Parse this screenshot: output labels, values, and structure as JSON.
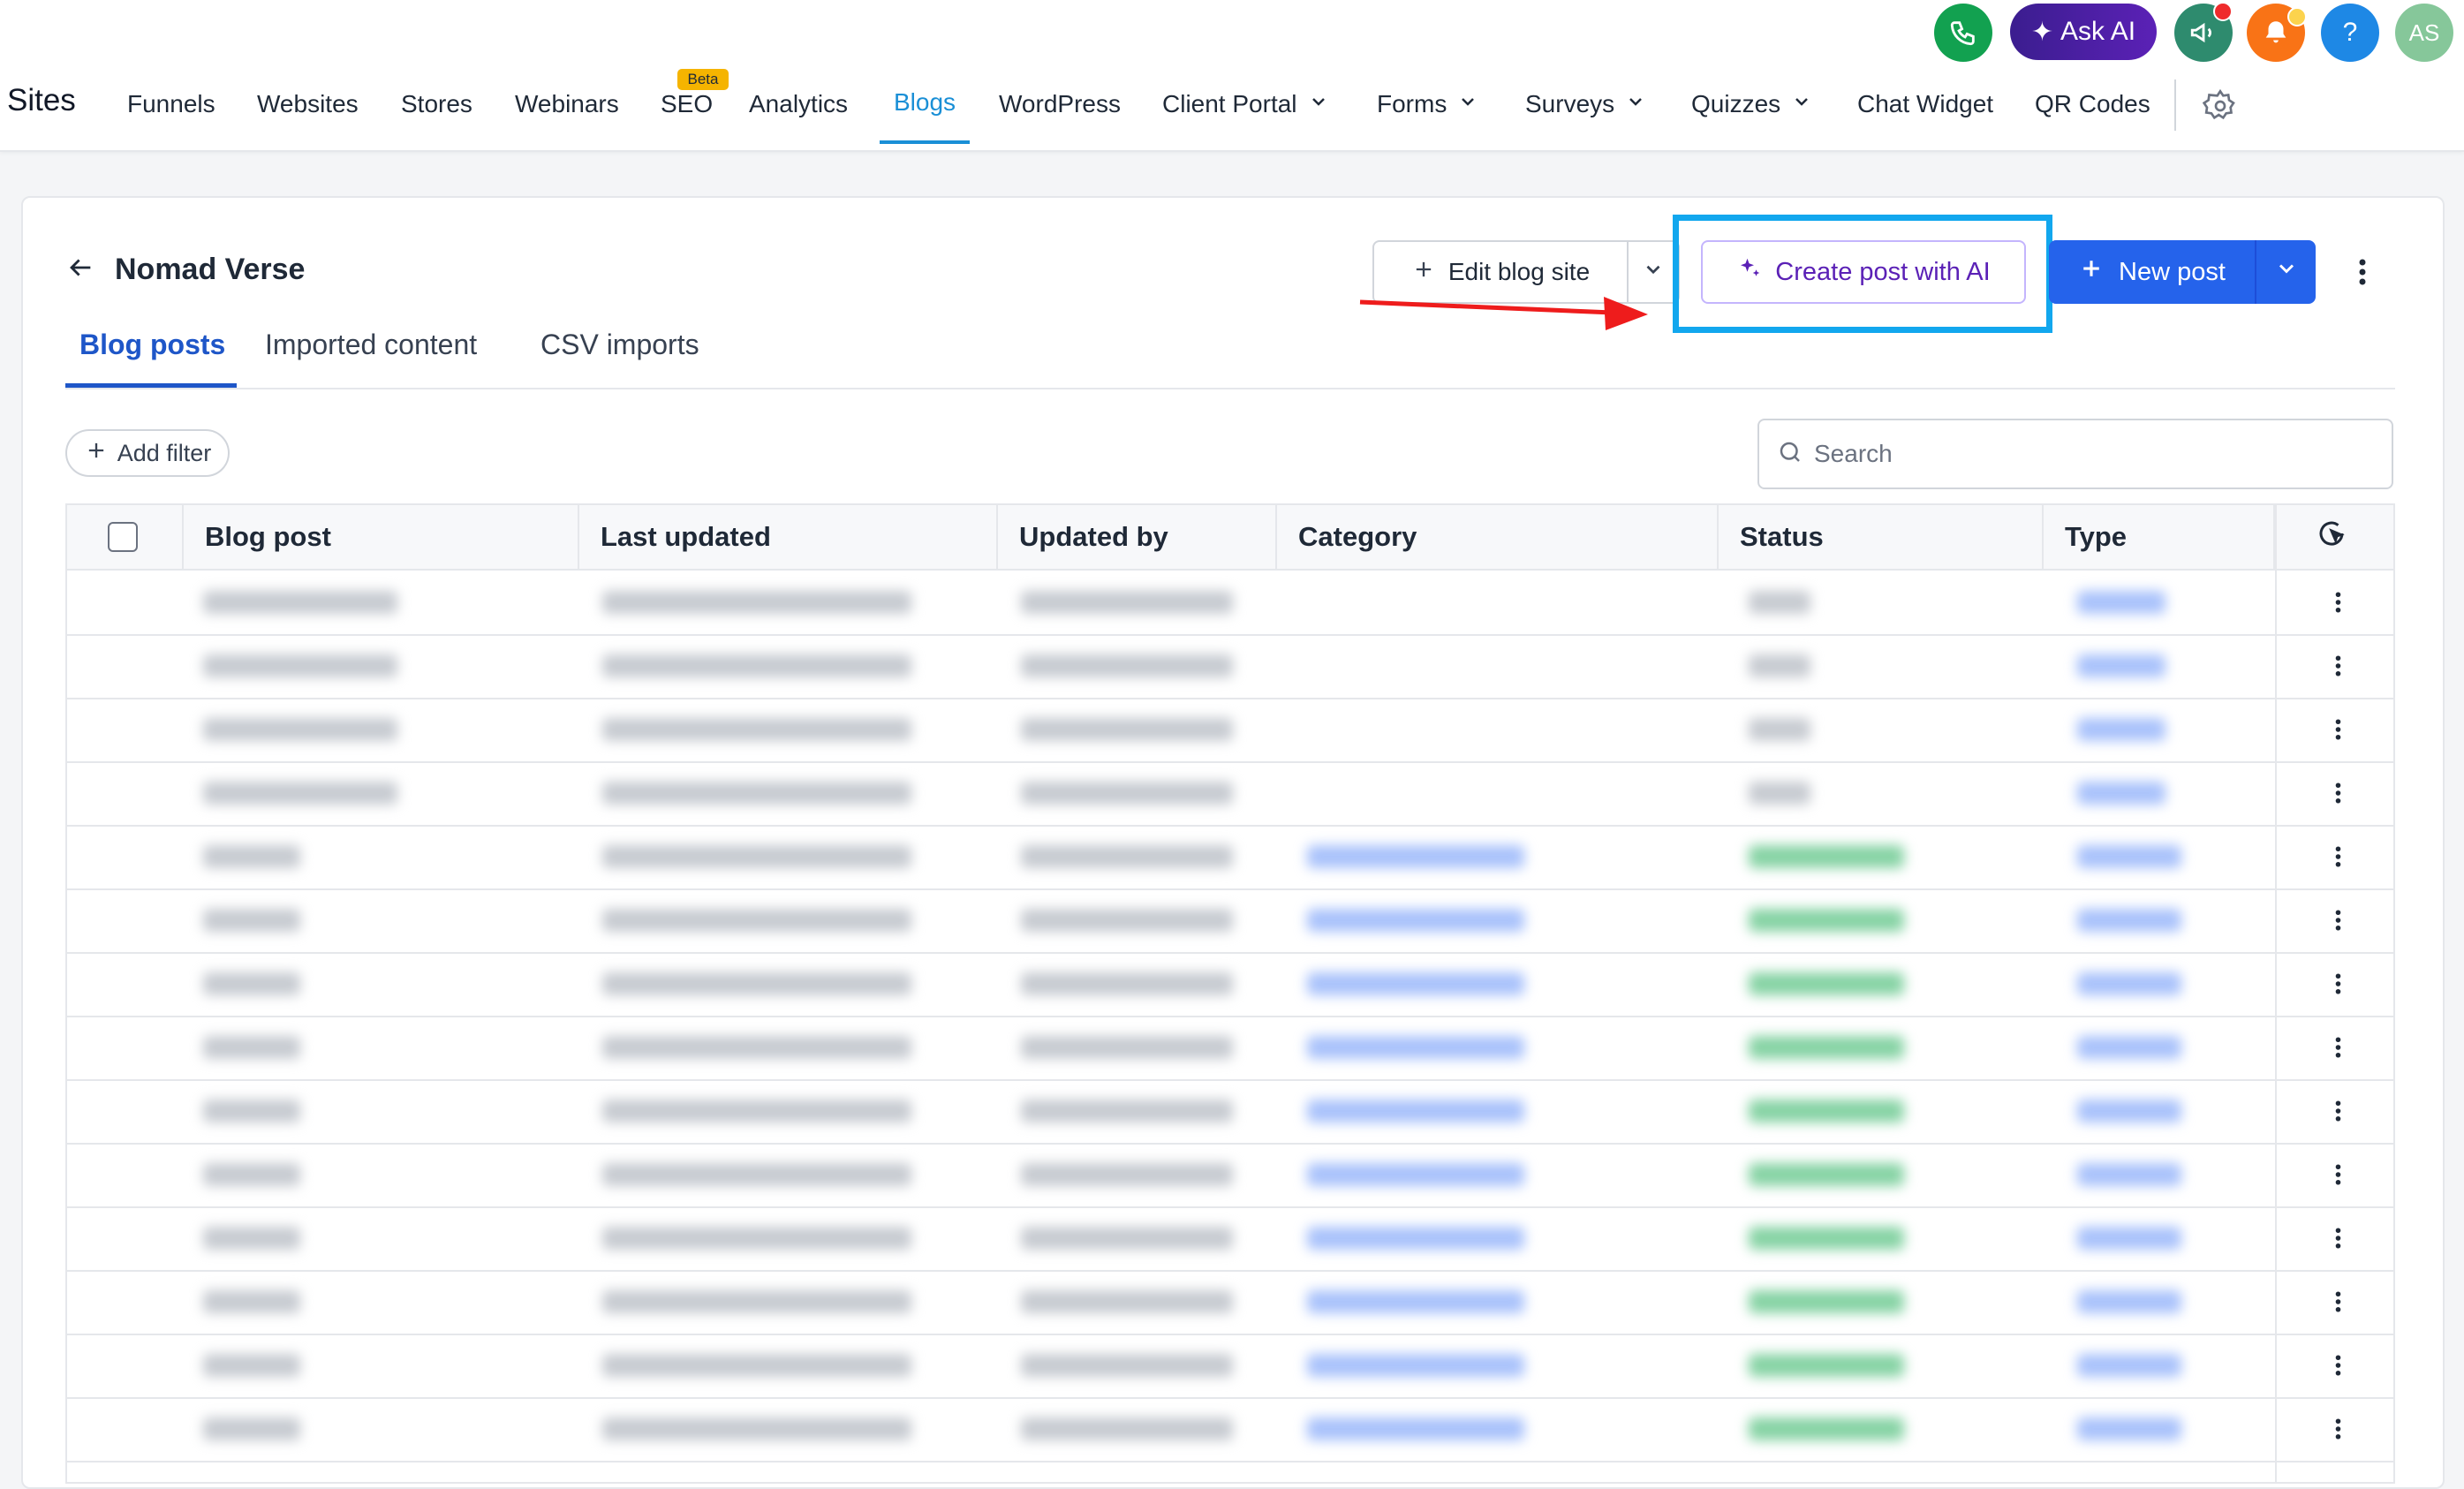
{
  "header": {
    "ask_ai_label": "Ask AI",
    "avatar_initials": "AS",
    "help_label": "?"
  },
  "nav": {
    "brand": "Sites",
    "items": [
      {
        "label": "Funnels"
      },
      {
        "label": "Websites"
      },
      {
        "label": "Stores"
      },
      {
        "label": "Webinars"
      },
      {
        "label": "SEO",
        "badge": "Beta"
      },
      {
        "label": "Analytics"
      },
      {
        "label": "Blogs",
        "active": true
      },
      {
        "label": "WordPress"
      },
      {
        "label": "Client Portal",
        "dropdown": true
      },
      {
        "label": "Forms",
        "dropdown": true
      },
      {
        "label": "Surveys",
        "dropdown": true
      },
      {
        "label": "Quizzes",
        "dropdown": true
      },
      {
        "label": "Chat Widget"
      },
      {
        "label": "QR Codes"
      }
    ]
  },
  "page": {
    "title": "Nomad Verse",
    "edit_label": "Edit blog site",
    "ai_label": "Create post with AI",
    "new_label": "New post",
    "tabs": [
      "Blog posts",
      "Imported content",
      "CSV imports"
    ],
    "add_filter_label": "Add filter",
    "search_placeholder": "Search"
  },
  "table": {
    "columns": [
      "Blog post",
      "Last updated",
      "Updated by",
      "Category",
      "Status",
      "Type"
    ],
    "rows_blurred": true
  },
  "colors": {
    "accent": "#1a8fd6",
    "primary_button": "#2563eb",
    "ai_purple": "#5b21b6",
    "highlight": "#12a7ee",
    "arrow": "#ee1c1c"
  }
}
